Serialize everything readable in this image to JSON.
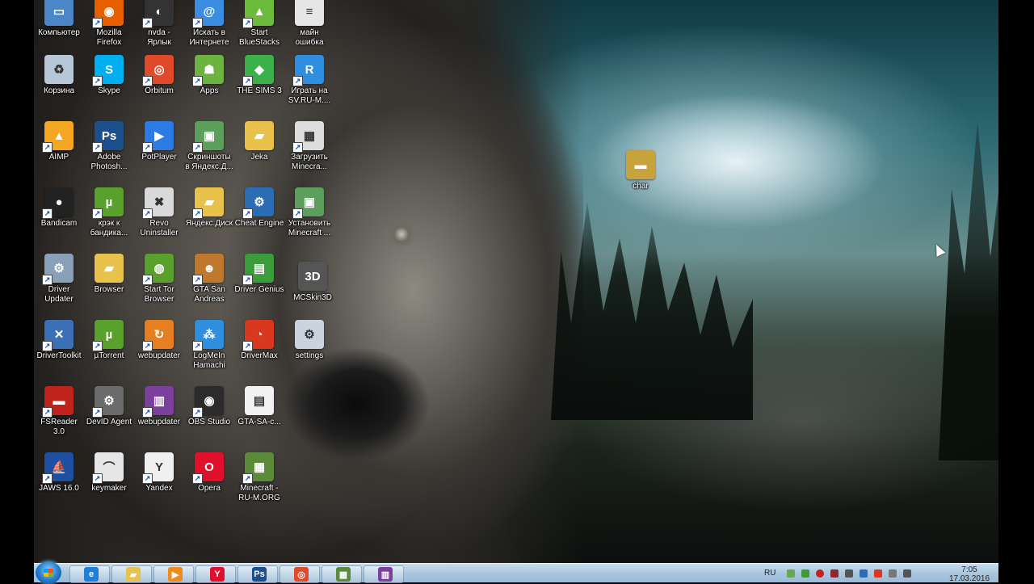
{
  "icons": [
    {
      "label": "Компьютер",
      "icon": "computer-icon",
      "color": "#4a86c8",
      "glyph": "▭",
      "shortcut": false
    },
    {
      "label": "Mozilla\nFirefox",
      "icon": "firefox-icon",
      "color": "#e66000",
      "glyph": "◉",
      "shortcut": true
    },
    {
      "label": "nvda -\nЯрлык",
      "icon": "nvda-icon",
      "color": "#333333",
      "glyph": "◐",
      "shortcut": true
    },
    {
      "label": "Искать в\nИнтернете",
      "icon": "search-web-icon",
      "color": "#3a8de0",
      "glyph": "@",
      "shortcut": true
    },
    {
      "label": "Start\nBlueStacks",
      "icon": "bluestacks-icon",
      "color": "#6dbb3c",
      "glyph": "▲",
      "shortcut": true
    },
    {
      "label": "майн\nошибка",
      "icon": "text-file-icon",
      "color": "#e6e6e6",
      "glyph": "≡",
      "shortcut": false
    },
    {
      "label": "Корзина",
      "icon": "recycle-bin-icon",
      "color": "#b8c7d6",
      "glyph": "♻",
      "shortcut": false
    },
    {
      "label": "Skype",
      "icon": "skype-icon",
      "color": "#00aff0",
      "glyph": "S",
      "shortcut": true
    },
    {
      "label": "Orbitum",
      "icon": "orbitum-icon",
      "color": "#e04a2a",
      "glyph": "◎",
      "shortcut": true
    },
    {
      "label": "Apps",
      "icon": "apps-icon",
      "color": "#6cb33f",
      "glyph": "☗",
      "shortcut": true
    },
    {
      "label": "THE SIMS 3",
      "icon": "sims-icon",
      "color": "#3cb04a",
      "glyph": "◆",
      "shortcut": true
    },
    {
      "label": "Играть на\nSV.RU-M....",
      "icon": "game-r-icon",
      "color": "#2e8fe0",
      "glyph": "R",
      "shortcut": true
    },
    {
      "label": "AIMP",
      "icon": "aimp-icon",
      "color": "#f5a623",
      "glyph": "▲",
      "shortcut": true
    },
    {
      "label": "Adobe\nPhotosh...",
      "icon": "photoshop-icon",
      "color": "#1d4f8c",
      "glyph": "Ps",
      "shortcut": true
    },
    {
      "label": "PotPlayer",
      "icon": "potplayer-icon",
      "color": "#2c7be5",
      "glyph": "▶",
      "shortcut": true
    },
    {
      "label": "Скриншоты\nв Яндекс.Д...",
      "icon": "screenshot-icon",
      "color": "#5c9e5c",
      "glyph": "▣",
      "shortcut": true
    },
    {
      "label": "Jeka",
      "icon": "folder-icon",
      "color": "#e8c24a",
      "glyph": "▰",
      "shortcut": false
    },
    {
      "label": "Загрузить\nMinecra...",
      "icon": "calendar-app-icon",
      "color": "#dddddd",
      "glyph": "▦",
      "shortcut": true
    },
    {
      "label": "Bandicam",
      "icon": "bandicam-icon",
      "color": "#222222",
      "glyph": "●",
      "shortcut": true
    },
    {
      "label": "крэк к\nбандика...",
      "icon": "utorrent-icon",
      "color": "#5aa02c",
      "glyph": "µ",
      "shortcut": true
    },
    {
      "label": "Revo\nUninstaller",
      "icon": "revo-icon",
      "color": "#d9d9d9",
      "glyph": "✖",
      "shortcut": true
    },
    {
      "label": "Яндекс.Диск",
      "icon": "yandex-disk-folder-icon",
      "color": "#e8c24a",
      "glyph": "▰",
      "shortcut": true
    },
    {
      "label": "Cheat Engine",
      "icon": "cheat-engine-icon",
      "color": "#2a6db5",
      "glyph": "⚙",
      "shortcut": true
    },
    {
      "label": "Установить\nMinecraft ...",
      "icon": "installer-icon",
      "color": "#5c9e5c",
      "glyph": "▣",
      "shortcut": true
    },
    {
      "label": "Driver\nUpdater",
      "icon": "driver-updater-icon",
      "color": "#8aa0b8",
      "glyph": "⚙",
      "shortcut": true
    },
    {
      "label": "Browser",
      "icon": "folder-icon",
      "color": "#e8c24a",
      "glyph": "▰",
      "shortcut": false
    },
    {
      "label": "Start Tor\nBrowser",
      "icon": "tor-icon",
      "color": "#5aa02c",
      "glyph": "◍",
      "shortcut": true
    },
    {
      "label": "GTA San\nAndreas",
      "icon": "gta-icon",
      "color": "#c0782c",
      "glyph": "☻",
      "shortcut": true
    },
    {
      "label": "Driver Genius",
      "icon": "driver-genius-icon",
      "color": "#3a9c3a",
      "glyph": "▤",
      "shortcut": true
    },
    {
      "label": "DriverToolkit",
      "icon": "driver-toolkit-icon",
      "color": "#3b6fb6",
      "glyph": "✕",
      "shortcut": true
    },
    {
      "label": "µTorrent",
      "icon": "utorrent-icon",
      "color": "#5aa02c",
      "glyph": "µ",
      "shortcut": true
    },
    {
      "label": "webupdater",
      "icon": "webupdater-icon",
      "color": "#e67e22",
      "glyph": "↻",
      "shortcut": true
    },
    {
      "label": "LogMeIn\nHamachi",
      "icon": "hamachi-icon",
      "color": "#2e8fe0",
      "glyph": "⁂",
      "shortcut": true
    },
    {
      "label": "DriverMax",
      "icon": "drivermax-icon",
      "color": "#d9381e",
      "glyph": "◔",
      "shortcut": true
    },
    {
      "label": "settings",
      "icon": "settings-file-icon",
      "color": "#c9d4df",
      "glyph": "⚙",
      "shortcut": false
    },
    {
      "label": "FSReader 3.0",
      "icon": "fsreader-icon",
      "color": "#c0221c",
      "glyph": "▬",
      "shortcut": true
    },
    {
      "label": "DevID Agent",
      "icon": "gear-icon",
      "color": "#6b6b6b",
      "glyph": "⚙",
      "shortcut": true
    },
    {
      "label": "webupdater",
      "icon": "winrar-icon",
      "color": "#7b3f9e",
      "glyph": "▥",
      "shortcut": true
    },
    {
      "label": "OBS Studio",
      "icon": "obs-icon",
      "color": "#2b2b2b",
      "glyph": "◉",
      "shortcut": true
    },
    {
      "label": "GTA-SA-c...",
      "icon": "docx-file-icon",
      "color": "#f2f2f2",
      "glyph": "▤",
      "shortcut": false
    },
    {
      "label": "JAWS 16.0",
      "icon": "jaws-icon",
      "color": "#1f4fa0",
      "glyph": "⛵",
      "shortcut": true
    },
    {
      "label": "keymaker",
      "icon": "keymaker-icon",
      "color": "#e6e6e6",
      "glyph": "⌒",
      "shortcut": true
    },
    {
      "label": "Yandex",
      "icon": "yandex-browser-icon",
      "color": "#f0f0f0",
      "glyph": "Y",
      "shortcut": true
    },
    {
      "label": "Opera",
      "icon": "opera-icon",
      "color": "#e0102c",
      "glyph": "O",
      "shortcut": true
    },
    {
      "label": "Minecraft -\nRU-M.ORG",
      "icon": "minecraft-icon",
      "color": "#5a8a3a",
      "glyph": "▦",
      "shortcut": true
    },
    {
      "label": "MCSkin3D",
      "icon": "mcskin3d-icon",
      "color": "#555555",
      "glyph": "3D",
      "shortcut": false
    },
    {
      "label": "char",
      "icon": "char-image-icon",
      "color": "#c8a23a",
      "glyph": "▬",
      "shortcut": false
    }
  ],
  "taskbar": {
    "items": [
      {
        "icon": "ie-icon",
        "glyph": "e",
        "color": "#1e7fd6"
      },
      {
        "icon": "explorer-folder-icon",
        "glyph": "▰",
        "color": "#e8c24a"
      },
      {
        "icon": "media-player-icon",
        "glyph": "▶",
        "color": "#f08a1a"
      },
      {
        "icon": "yandex-browser-icon",
        "glyph": "Y",
        "color": "#e0102c"
      },
      {
        "icon": "photoshop-icon",
        "glyph": "Ps",
        "color": "#1d4f8c"
      },
      {
        "icon": "orbitum-icon",
        "glyph": "◎",
        "color": "#e04a2a"
      },
      {
        "icon": "minecraft-icon",
        "glyph": "▦",
        "color": "#5a8a3a"
      },
      {
        "icon": "winrar-icon",
        "glyph": "▥",
        "color": "#7b3f9e"
      }
    ],
    "language": "RU",
    "time": "7:05",
    "date": "17.03.2016"
  }
}
